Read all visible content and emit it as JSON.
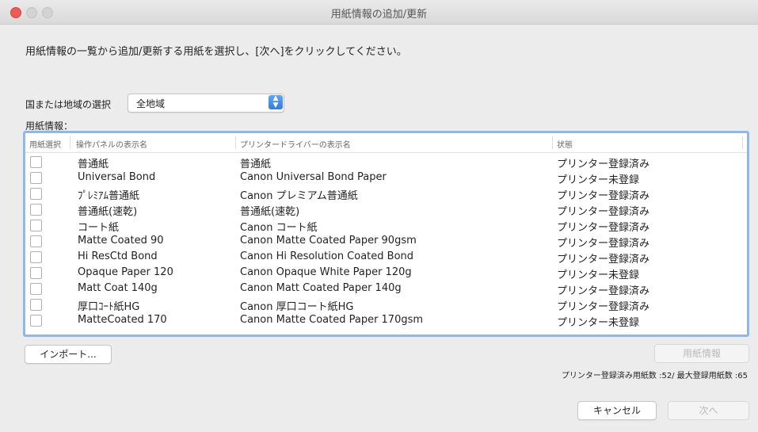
{
  "window": {
    "title": "用紙情報の追加/更新"
  },
  "instruction": "用紙情報の一覧から追加/更新する用紙を選択し、[次へ]をクリックしてください。",
  "region": {
    "label": "国または地域の選択",
    "value": "全地域"
  },
  "paper_info_label": "用紙情報：",
  "table": {
    "columns": [
      "用紙選択",
      "操作パネルの表示名",
      "プリンタードライバーの表示名",
      "状態"
    ],
    "rows": [
      {
        "checked": false,
        "panel_name": "普通紙",
        "driver_name": "普通紙",
        "status": "プリンター登録済み"
      },
      {
        "checked": false,
        "panel_name": "Universal Bond",
        "driver_name": "Canon Universal Bond Paper",
        "status": "プリンター未登録"
      },
      {
        "checked": false,
        "panel_name": "ﾌﾟﾚﾐｱﾑ普通紙",
        "driver_name": "Canon プレミアム普通紙",
        "status": "プリンター登録済み"
      },
      {
        "checked": false,
        "panel_name": "普通紙(速乾)",
        "driver_name": "普通紙(速乾)",
        "status": "プリンター登録済み"
      },
      {
        "checked": false,
        "panel_name": "コート紙",
        "driver_name": "Canon コート紙",
        "status": "プリンター登録済み"
      },
      {
        "checked": false,
        "panel_name": "Matte Coated 90",
        "driver_name": "Canon Matte Coated Paper 90gsm",
        "status": "プリンター登録済み"
      },
      {
        "checked": false,
        "panel_name": "Hi ResCtd Bond",
        "driver_name": "Canon Hi Resolution Coated Bond",
        "status": "プリンター登録済み"
      },
      {
        "checked": false,
        "panel_name": "Opaque Paper 120",
        "driver_name": "Canon Opaque White Paper 120g",
        "status": "プリンター未登録"
      },
      {
        "checked": false,
        "panel_name": "Matt Coat 140g",
        "driver_name": "Canon Matt Coated Paper 140g",
        "status": "プリンター登録済み"
      },
      {
        "checked": false,
        "panel_name": "厚口ｺｰﾄ紙HG",
        "driver_name": "Canon 厚口コート紙HG",
        "status": "プリンター登録済み"
      },
      {
        "checked": false,
        "panel_name": "MatteCoated 170",
        "driver_name": "Canon Matte Coated Paper 170gsm",
        "status": "プリンター未登録"
      }
    ]
  },
  "buttons": {
    "import": "インポート...",
    "paper_info": "用紙情報",
    "cancel": "キャンセル",
    "next": "次へ"
  },
  "count_text": "プリンター登録済み用紙数 :52/ 最大登録用紙数 :65",
  "colors": {
    "focus_ring": "#8fb7ea",
    "select_accent": "#2f7de0",
    "close_button": "#ee5b55"
  }
}
